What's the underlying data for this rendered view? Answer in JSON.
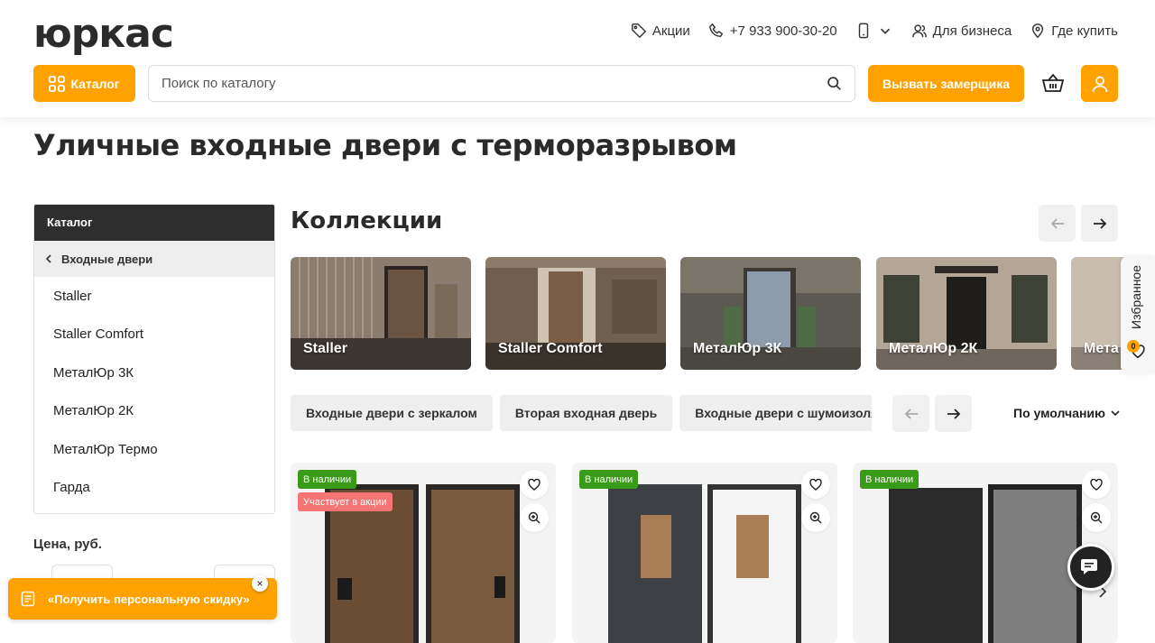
{
  "header": {
    "logo": "юркас",
    "links": {
      "sales": "Акции",
      "phone": "+7 933 900-30-20",
      "business": "Для бизнеса",
      "where_to_buy": "Где купить"
    },
    "catalog_button": "Каталог",
    "search": {
      "placeholder": "Поиск по каталогу"
    },
    "measure_button": "Вызвать замерщика"
  },
  "page": {
    "title": "Уличные входные двери с терморазрывом"
  },
  "sidebar": {
    "heading": "Каталог",
    "parent": "Входные двери",
    "items": [
      "Staller",
      "Staller Comfort",
      "МеталЮр 3К",
      "МеталЮр 2К",
      "МеталЮр Термо",
      "Гарда"
    ]
  },
  "filters": {
    "price_label": "Цена, руб."
  },
  "collections": {
    "title": "Коллекции",
    "cards": [
      {
        "label": "Staller",
        "color": "#8a7d70"
      },
      {
        "label": "Staller Comfort",
        "color": "#6e5f50"
      },
      {
        "label": "МеталЮр 3К",
        "color": "#6b6760"
      },
      {
        "label": "МеталЮр 2К",
        "color": "#a89a8c"
      },
      {
        "label": "Мета",
        "color": "#bfb3a5"
      }
    ]
  },
  "chips": [
    "Входные двери с зеркалом",
    "Вторая входная дверь",
    "Входные двери с шумоизоля"
  ],
  "sort": {
    "label": "По умолчанию"
  },
  "products": [
    {
      "badges": [
        "В наличии",
        "Участвует в акции"
      ]
    },
    {
      "badges": [
        "В наличии"
      ]
    },
    {
      "badges": [
        "В наличии"
      ]
    }
  ],
  "favorites": {
    "label": "Избранное",
    "count": "0"
  },
  "promo": {
    "text": "«Получить персональную скидку»",
    "close": "×"
  },
  "colors": {
    "accent": "#ffa200",
    "dark": "#2e2e2e",
    "stock_badge": "#3a9b19",
    "sale_badge": "#f57474"
  }
}
